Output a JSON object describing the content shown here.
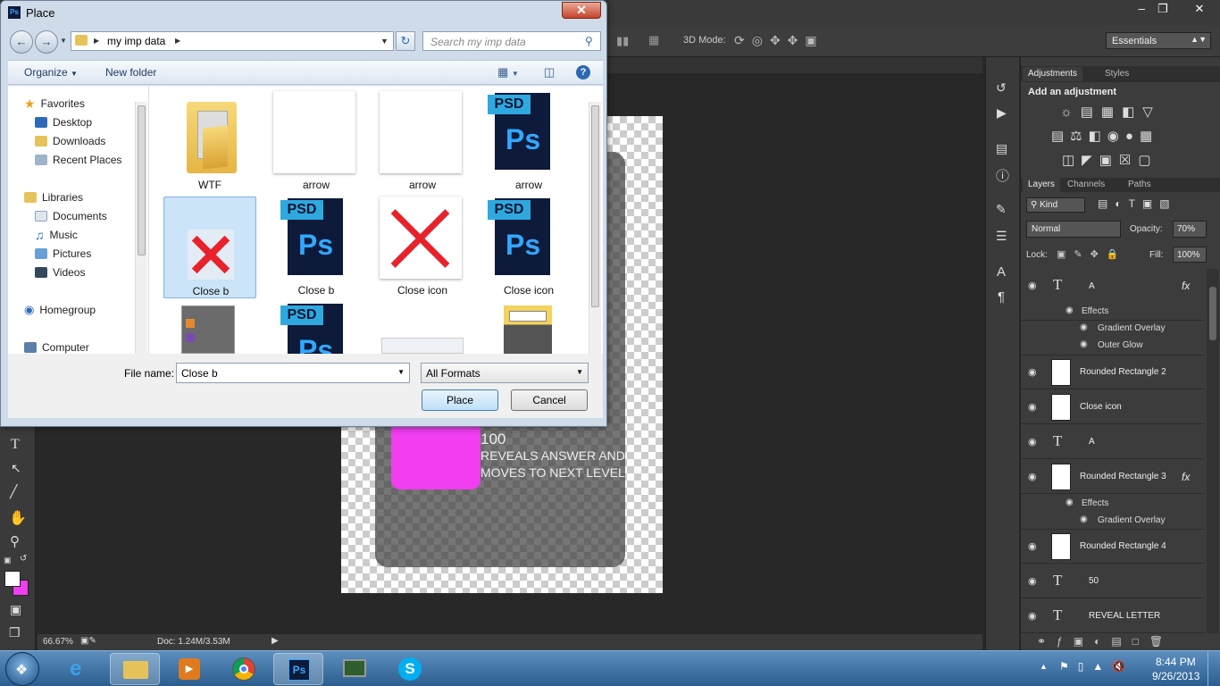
{
  "dialog": {
    "title": "Place",
    "path_folder": "my imp data",
    "search_placeholder": "Search my imp data",
    "toolbar": {
      "organize": "Organize",
      "new_folder": "New folder"
    },
    "nav": {
      "favorites": "Favorites",
      "desktop": "Desktop",
      "downloads": "Downloads",
      "recent_places": "Recent Places",
      "libraries": "Libraries",
      "documents": "Documents",
      "music": "Music",
      "pictures": "Pictures",
      "videos": "Videos",
      "homegroup": "Homegroup",
      "computer": "Computer"
    },
    "files": {
      "f1": "WTF",
      "f2": "arrow",
      "f3": "arrow",
      "f4": "arrow",
      "f5": "Close b",
      "f6": "Close b",
      "f7": "Close icon",
      "f8": "Close icon"
    },
    "psd_tag": "PSD",
    "ps_glyph": "Ps",
    "file_name_label": "File name:",
    "file_name_value": "Close b",
    "file_type_value": "All Formats",
    "place_button": "Place",
    "cancel_button": "Cancel"
  },
  "ps": {
    "three_d_mode": "3D Mode:",
    "workspace": "Essentials",
    "status_zoom": "66.67%",
    "status_doc": "Doc: 1.24M/3.53M",
    "canvas_text": {
      "number": "100",
      "line1": "REVEALS ANSWER AND",
      "line2": "MOVES TO NEXT LEVEL"
    },
    "adjustments_tab": "Adjustments",
    "styles_tab": "Styles",
    "add_adjustment": "Add an adjustment",
    "layers_tab": "Layers",
    "channels_tab": "Channels",
    "paths_tab": "Paths",
    "kind": "Kind",
    "blend_mode": "Normal",
    "opacity_label": "Opacity:",
    "opacity_value": "70%",
    "lock_label": "Lock:",
    "fill_label": "Fill:",
    "fill_value": "100%",
    "fx": "fx",
    "text_glyph": "T",
    "layers": {
      "l1": "A",
      "effects": "Effects",
      "gradient_overlay": "Gradient Overlay",
      "outer_glow": "Outer Glow",
      "l2": "Rounded Rectangle 2",
      "l3": "Close icon",
      "l4": "A",
      "l5": "Rounded Rectangle 3",
      "l6": "Rounded Rectangle 4",
      "l7": "50",
      "l8": "REVEAL LETTER"
    }
  },
  "taskbar": {
    "time": "8:44 PM",
    "date": "9/26/2013"
  },
  "colors": {
    "accent_blue": "#2fa8e0",
    "close_red": "#e8222b",
    "canvas_pink": "#f03ef0"
  }
}
